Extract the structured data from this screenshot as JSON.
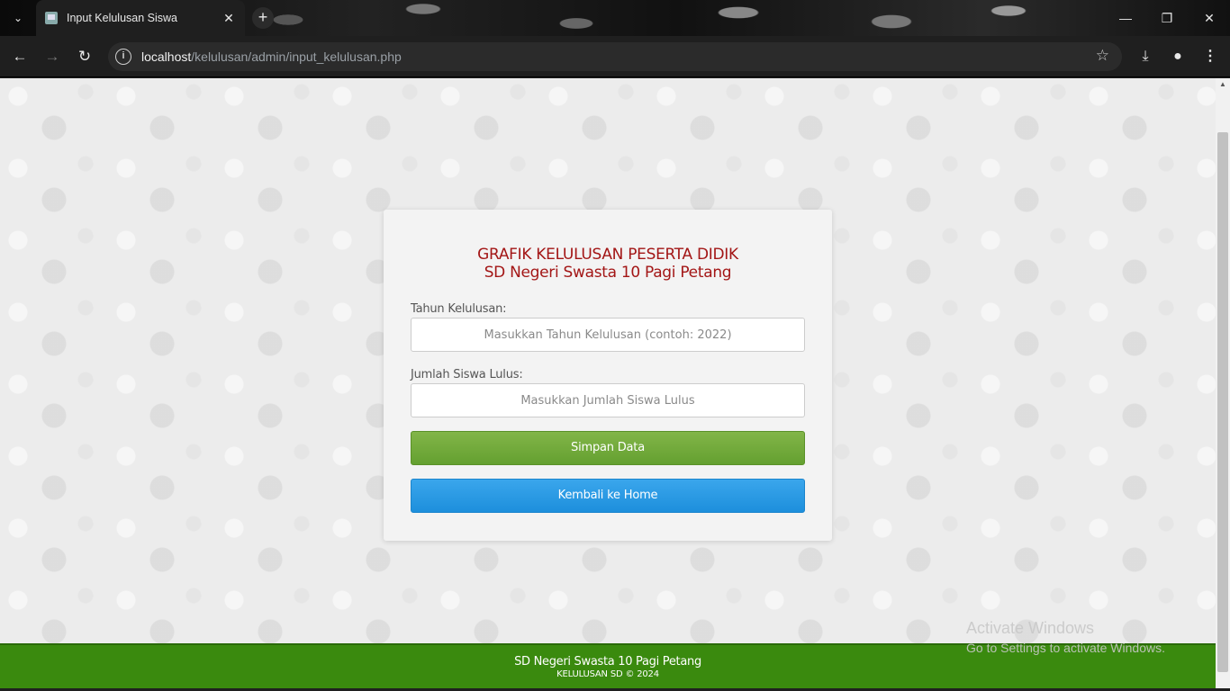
{
  "browser": {
    "tab_title": "Input Kelulusan Siswa",
    "url_host": "localhost",
    "url_path": "/kelulusan/admin/input_kelulusan.php"
  },
  "form": {
    "title_line1": "GRAFIK KELULUSAN PESERTA DIDIK",
    "title_line2": "SD Negeri Swasta 10 Pagi Petang",
    "year_label": "Tahun Kelulusan:",
    "year_placeholder": "Masukkan Tahun Kelulusan (contoh: 2022)",
    "count_label": "Jumlah Siswa Lulus:",
    "count_placeholder": "Masukkan Jumlah Siswa Lulus",
    "save_label": "Simpan Data",
    "home_label": "Kembali ke Home"
  },
  "footer": {
    "school": "SD Negeri Swasta 10 Pagi Petang",
    "copyright": "KELULUSAN SD © 2024"
  },
  "watermark": {
    "title": "Activate Windows",
    "subtitle": "Go to Settings to activate Windows."
  },
  "colors": {
    "title": "#a31616",
    "save_button": "#6aa436",
    "home_button": "#2a9be6",
    "footer": "#3a8a0e"
  }
}
